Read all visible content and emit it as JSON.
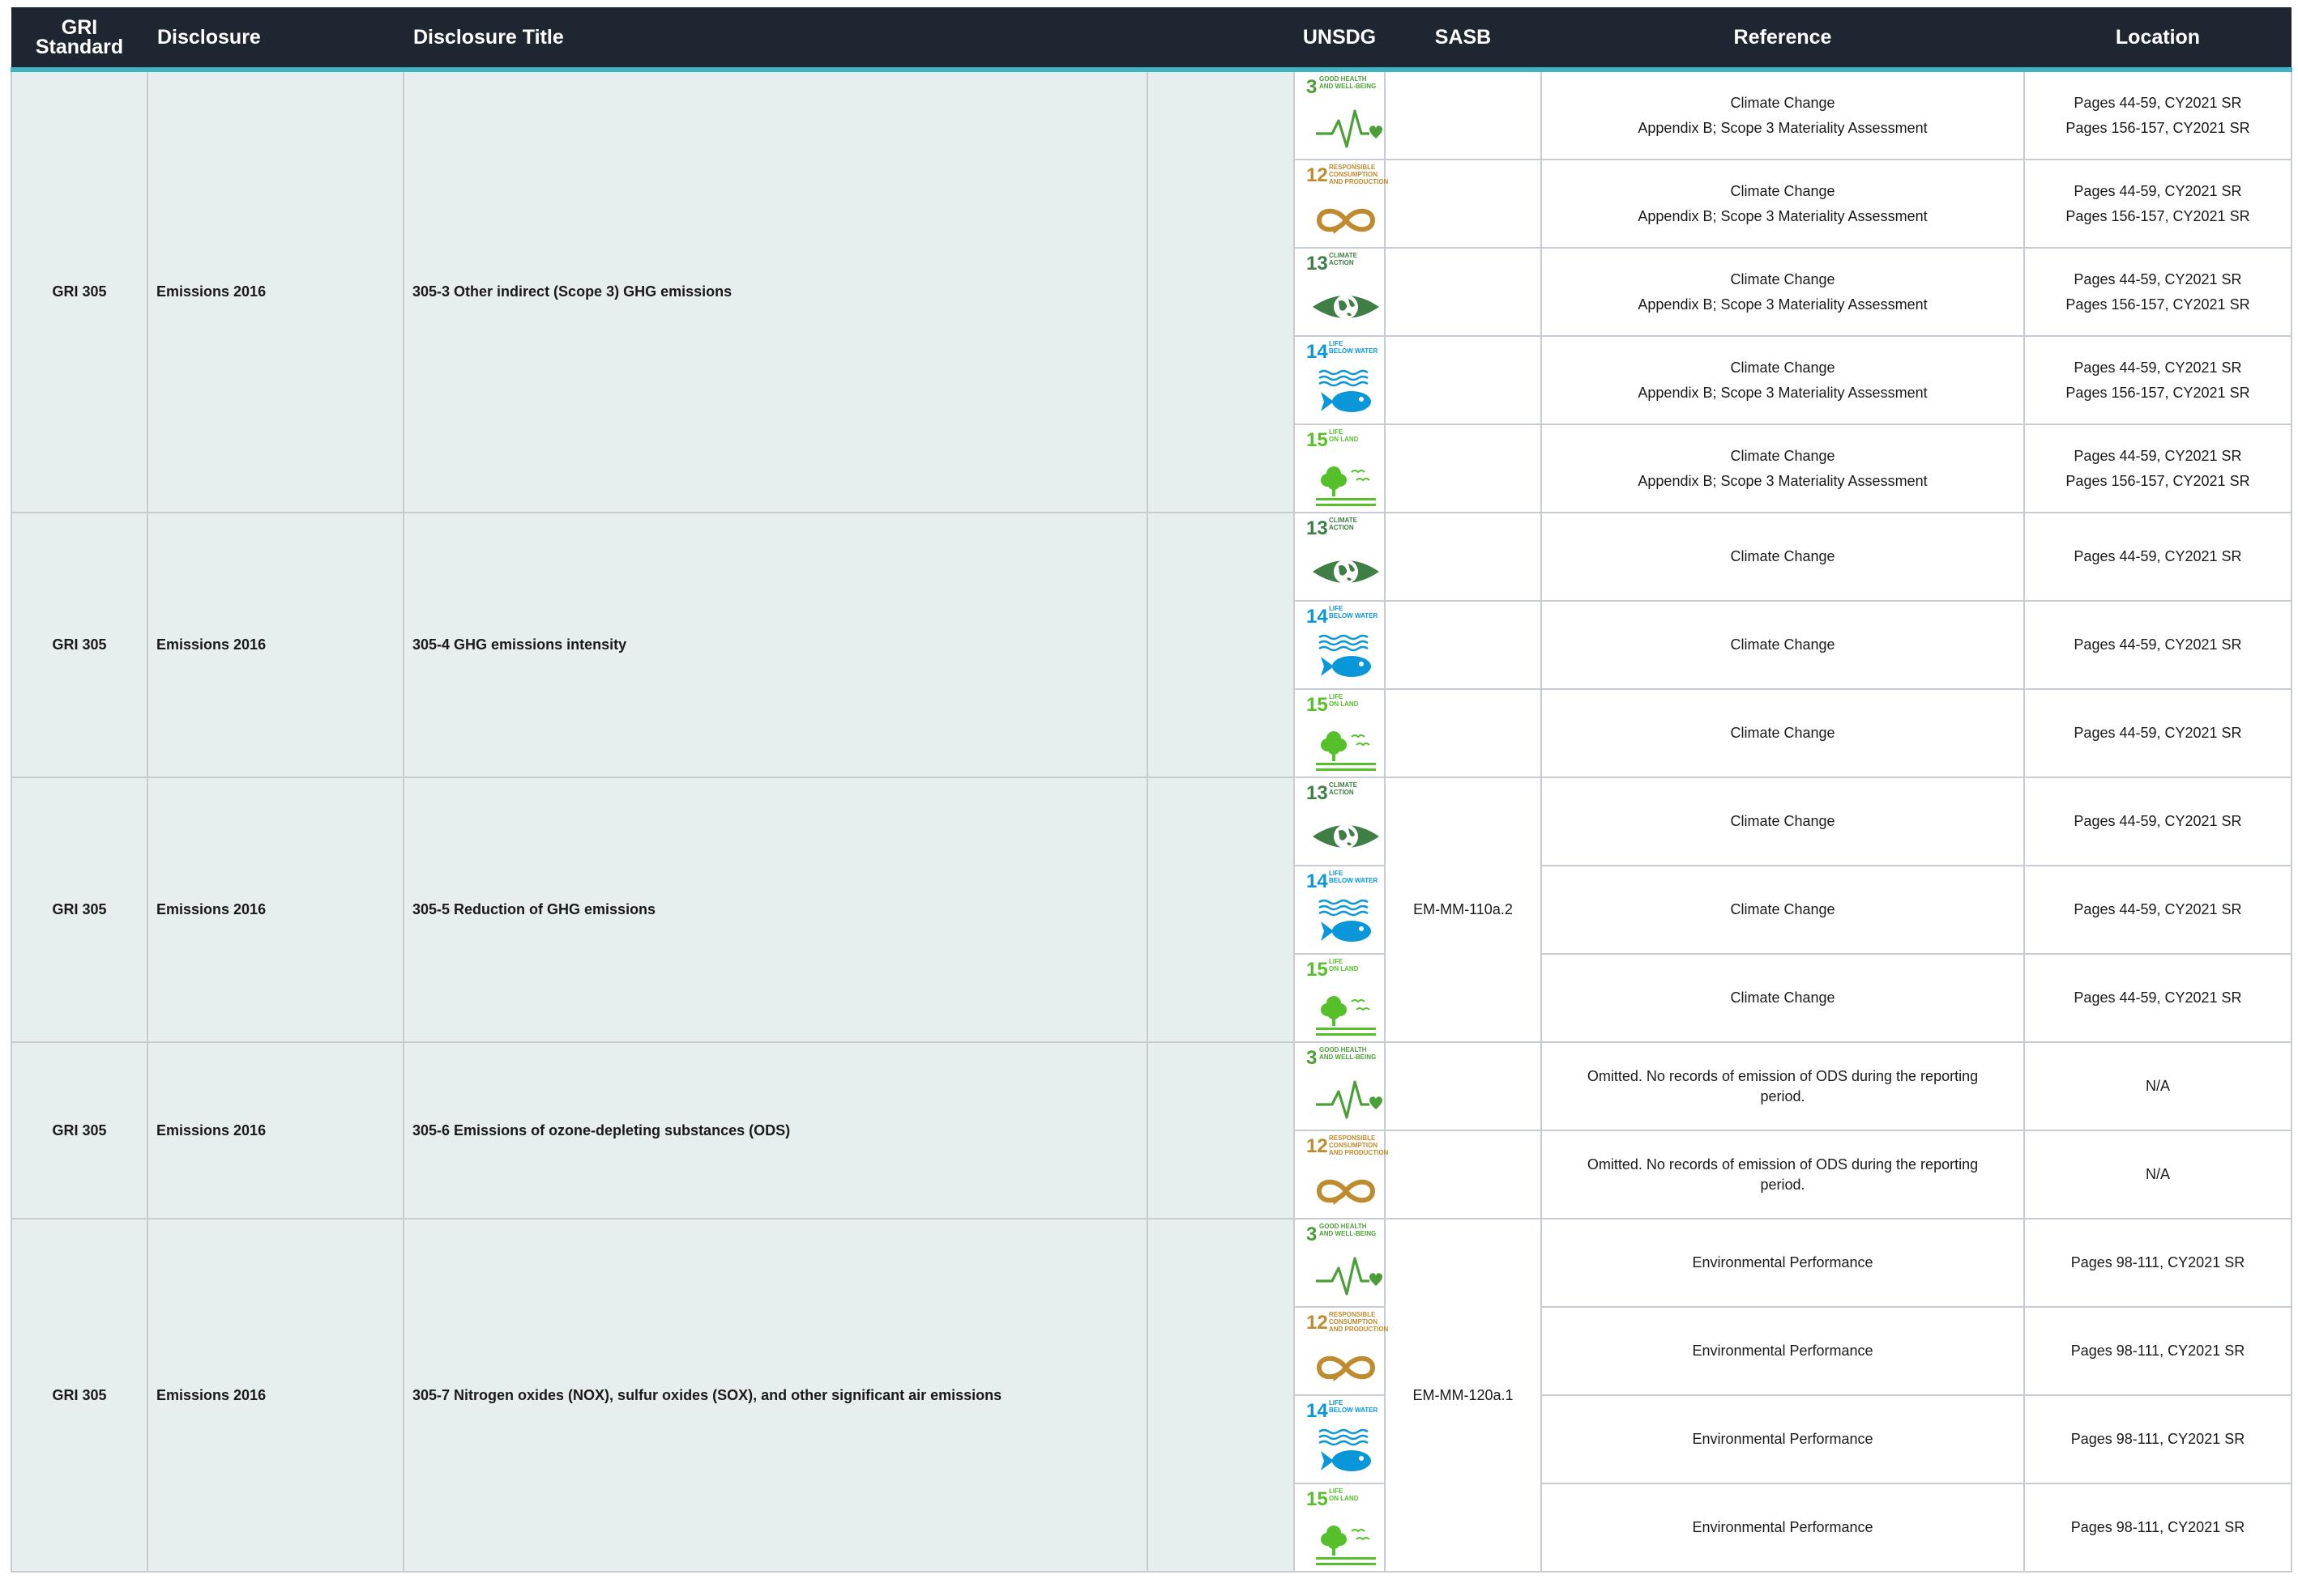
{
  "header": {
    "gri_standard": [
      "GRI",
      "Standard"
    ],
    "disclosure": "Disclosure",
    "disclosure_title": "Disclosure Title",
    "unsdg": "UNSDG",
    "sasb": "SASB",
    "reference": "Reference",
    "location": "Location"
  },
  "sdg_tiles": {
    "3": {
      "number": "3",
      "caption": [
        "GOOD HEALTH",
        "AND WELL-BEING"
      ],
      "color": "#4c9f38",
      "icon": "heartbeat-icon"
    },
    "12": {
      "number": "12",
      "caption": [
        "RESPONSIBLE",
        "CONSUMPTION",
        "AND PRODUCTION"
      ],
      "color": "#bf8b2e",
      "icon": "infinity-loop-icon"
    },
    "13": {
      "number": "13",
      "caption": [
        "CLIMATE",
        "ACTION"
      ],
      "color": "#3f7e44",
      "icon": "earth-eye-icon"
    },
    "14": {
      "number": "14",
      "caption": [
        "LIFE",
        "BELOW WATER"
      ],
      "color": "#0a97d9",
      "icon": "fish-waves-icon"
    },
    "15": {
      "number": "15",
      "caption": [
        "LIFE",
        "ON LAND"
      ],
      "color": "#56c02b",
      "icon": "tree-birds-icon"
    }
  },
  "groups": [
    {
      "standard": "GRI 305",
      "disclosure": "Emissions 2016",
      "title": "305-3 Other indirect (Scope 3) GHG emissions",
      "sasb": "",
      "rows": [
        {
          "sdg": "3",
          "reference": [
            "Climate Change",
            "Appendix B; Scope 3 Materiality Assessment"
          ],
          "location": [
            "Pages 44-59, CY2021 SR",
            "Pages 156-157, CY2021 SR"
          ]
        },
        {
          "sdg": "12",
          "reference": [
            "Climate Change",
            "Appendix B; Scope 3 Materiality Assessment"
          ],
          "location": [
            "Pages 44-59, CY2021 SR",
            "Pages 156-157, CY2021 SR"
          ]
        },
        {
          "sdg": "13",
          "reference": [
            "Climate Change",
            "Appendix B; Scope 3 Materiality Assessment"
          ],
          "location": [
            "Pages 44-59, CY2021 SR",
            "Pages 156-157, CY2021 SR"
          ]
        },
        {
          "sdg": "14",
          "reference": [
            "Climate Change",
            "Appendix B; Scope 3 Materiality Assessment"
          ],
          "location": [
            "Pages 44-59, CY2021 SR",
            "Pages 156-157, CY2021 SR"
          ]
        },
        {
          "sdg": "15",
          "reference": [
            "Climate Change",
            "Appendix B; Scope 3 Materiality Assessment"
          ],
          "location": [
            "Pages 44-59, CY2021 SR",
            "Pages 156-157, CY2021 SR"
          ]
        }
      ]
    },
    {
      "standard": "GRI 305",
      "disclosure": "Emissions 2016",
      "title": "305-4 GHG emissions intensity",
      "sasb": "",
      "rows": [
        {
          "sdg": "13",
          "reference": [
            "Climate Change"
          ],
          "location": [
            "Pages 44-59, CY2021 SR"
          ]
        },
        {
          "sdg": "14",
          "reference": [
            "Climate Change"
          ],
          "location": [
            "Pages 44-59, CY2021 SR"
          ]
        },
        {
          "sdg": "15",
          "reference": [
            "Climate Change"
          ],
          "location": [
            "Pages 44-59, CY2021 SR"
          ]
        }
      ]
    },
    {
      "standard": "GRI 305",
      "disclosure": "Emissions 2016",
      "title": "305-5 Reduction of GHG emissions",
      "sasb": "EM-MM-110a.2",
      "rows": [
        {
          "sdg": "13",
          "reference": [
            "Climate Change"
          ],
          "location": [
            "Pages 44-59, CY2021 SR"
          ]
        },
        {
          "sdg": "14",
          "reference": [
            "Climate Change"
          ],
          "location": [
            "Pages 44-59, CY2021 SR"
          ]
        },
        {
          "sdg": "15",
          "reference": [
            "Climate Change"
          ],
          "location": [
            "Pages 44-59, CY2021 SR"
          ]
        }
      ]
    },
    {
      "standard": "GRI 305",
      "disclosure": "Emissions 2016",
      "title": "305-6 Emissions of ozone-depleting substances (ODS)",
      "sasb": "",
      "rows": [
        {
          "sdg": "3",
          "reference": [
            "Omitted.  No records of emission of ODS during the reporting",
            "period."
          ],
          "location": [
            "N/A"
          ]
        },
        {
          "sdg": "12",
          "reference": [
            "Omitted.  No records of emission of ODS during the reporting",
            "period."
          ],
          "location": [
            "N/A"
          ]
        }
      ]
    },
    {
      "standard": "GRI 305",
      "disclosure": "Emissions 2016",
      "title": "305-7 Nitrogen oxides (NOX), sulfur oxides (SOX), and other significant air emissions",
      "sasb": "EM-MM-120a.1",
      "rows": [
        {
          "sdg": "3",
          "reference": [
            "Environmental Performance"
          ],
          "location": [
            "Pages 98-111, CY2021 SR"
          ]
        },
        {
          "sdg": "12",
          "reference": [
            "Environmental Performance"
          ],
          "location": [
            "Pages 98-111, CY2021 SR"
          ]
        },
        {
          "sdg": "14",
          "reference": [
            "Environmental Performance"
          ],
          "location": [
            "Pages 98-111, CY2021 SR"
          ]
        },
        {
          "sdg": "15",
          "reference": [
            "Environmental Performance"
          ],
          "location": [
            "Pages 98-111, CY2021 SR"
          ]
        }
      ]
    }
  ]
}
